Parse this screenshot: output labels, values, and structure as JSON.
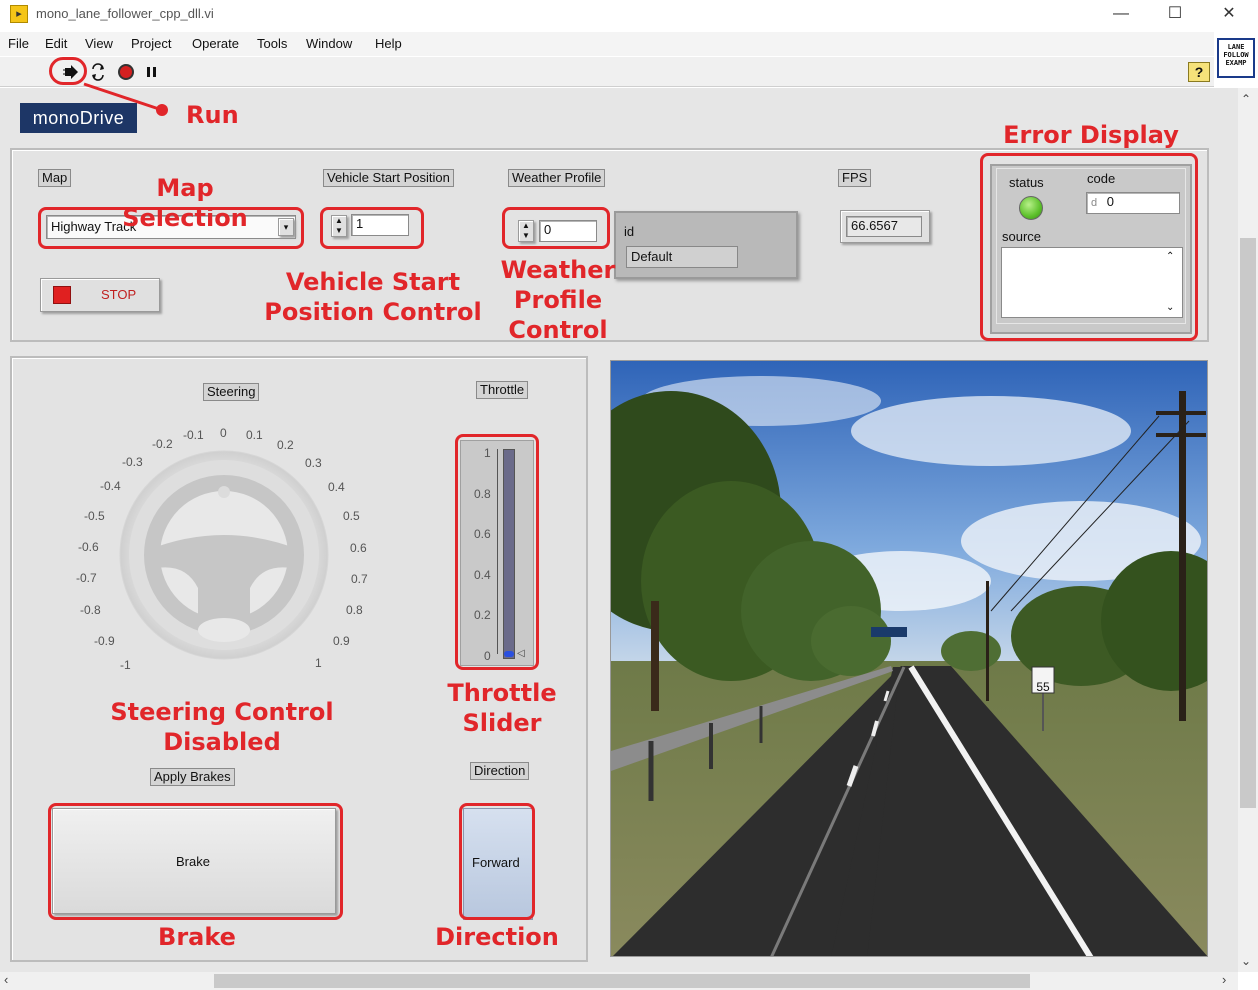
{
  "window": {
    "title": "mono_lane_follower_cpp_dll.vi",
    "minimize_glyph": "—",
    "maximize_glyph": "☐",
    "close_glyph": "✕"
  },
  "menu": {
    "items": [
      "File",
      "Edit",
      "View",
      "Project",
      "Operate",
      "Tools",
      "Window",
      "Help"
    ]
  },
  "toolbar": {
    "icons": [
      "run-arrow-icon",
      "run-continuously-icon",
      "abort-icon",
      "pause-icon"
    ],
    "help_glyph": "?",
    "vi_icon_text": [
      "LANE",
      "FOLLOW",
      "EXAMP"
    ]
  },
  "logo": {
    "text": "monoDrive"
  },
  "controls": {
    "map": {
      "label": "Map",
      "value": "Highway Track"
    },
    "start_position": {
      "label": "Vehicle Start Position",
      "value": "1"
    },
    "weather": {
      "label": "Weather Profile",
      "value": "0",
      "id_label": "id",
      "id_value": "Default"
    },
    "fps": {
      "label": "FPS",
      "value": "66.6567"
    },
    "stop_button": {
      "label": "STOP"
    },
    "error": {
      "status_label": "status",
      "code_label": "code",
      "code_prefix": "d",
      "code_value": "0",
      "source_label": "source"
    },
    "steering": {
      "label": "Steering",
      "ticks_left": [
        "-0.2",
        "-0.3",
        "-0.4",
        "-0.5",
        "-0.6",
        "-0.7",
        "-0.8",
        "-0.9",
        "-1"
      ],
      "ticks_top": [
        "-0.1",
        "0",
        "0.1",
        "0.2"
      ],
      "ticks_right": [
        "0.3",
        "0.4",
        "0.5",
        "0.6",
        "0.7",
        "0.8",
        "0.9",
        "1"
      ]
    },
    "throttle": {
      "label": "Throttle",
      "ticks": [
        "1",
        "0.8",
        "0.6",
        "0.4",
        "0.2",
        "0"
      ],
      "value": 0
    },
    "brakes": {
      "label": "Apply Brakes",
      "button": "Brake"
    },
    "direction": {
      "label": "Direction",
      "button": "Forward"
    }
  },
  "annotations": {
    "run": "Run",
    "map_selection": "Map Selection",
    "vehicle_start_1": "Vehicle  Start",
    "vehicle_start_2": "Position Control",
    "weather_1": "Weather",
    "weather_2": "Profile",
    "weather_3": "Control",
    "error_display": "Error Display",
    "steering_disabled": "Steering Control Disabled",
    "throttle_1": "Throttle",
    "throttle_2": "Slider",
    "brake": "Brake",
    "direction": "Direction"
  },
  "scene": {
    "speed_sign": "55"
  },
  "colors": {
    "annotation_red": "#e1262a",
    "logo_bg": "#1d3666",
    "status_led": "#5cc02a",
    "stop_square": "#e02020",
    "stop_text": "#c02020",
    "throttle_fill": "#6b6b8a",
    "direction_bg": "#c7d3e6"
  }
}
